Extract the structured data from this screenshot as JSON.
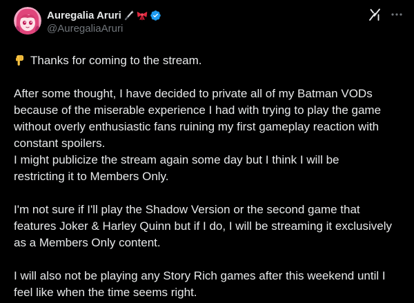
{
  "author": {
    "display_name": "Auregalia Aruri",
    "handle": "@AuregaliaAruri",
    "avatar_icon": "avatar-pink-hair",
    "badges": [
      "sparkle-wand-emoji",
      "ribbon-emoji",
      "verified-badge"
    ],
    "verified_color": "#1d9bf0"
  },
  "toolbar": {
    "grok_icon": "grok-icon",
    "more_icon": "more-icon"
  },
  "post": {
    "p1": "Thanks for coming to the stream.",
    "p2_l1": "After some thought, I have decided to private all of my Batman VODs",
    "p2_l2": "because of the miserable experience I had with trying to play the game",
    "p2_l3": "without overly enthusiastic fans ruining my first gameplay reaction with",
    "p2_l4": "constant spoilers.",
    "p2_l5": "I might publicize the stream again some day but I think I will be",
    "p2_l6": "restricting it to Members Only.",
    "p3_l1": "I'm not sure if I'll play the Shadow Version or the second game that",
    "p3_l2": "features Joker & Harley Quinn but if I do, I will be streaming it exclusively",
    "p3_l3": "as a Members Only content.",
    "p4_l1": "I will also not be playing any Story Rich games after this weekend until I",
    "p4_l2": "feel like when the time seems right."
  },
  "colors": {
    "background": "#000000",
    "text": "#e7e9ea",
    "secondary": "#71767b"
  }
}
